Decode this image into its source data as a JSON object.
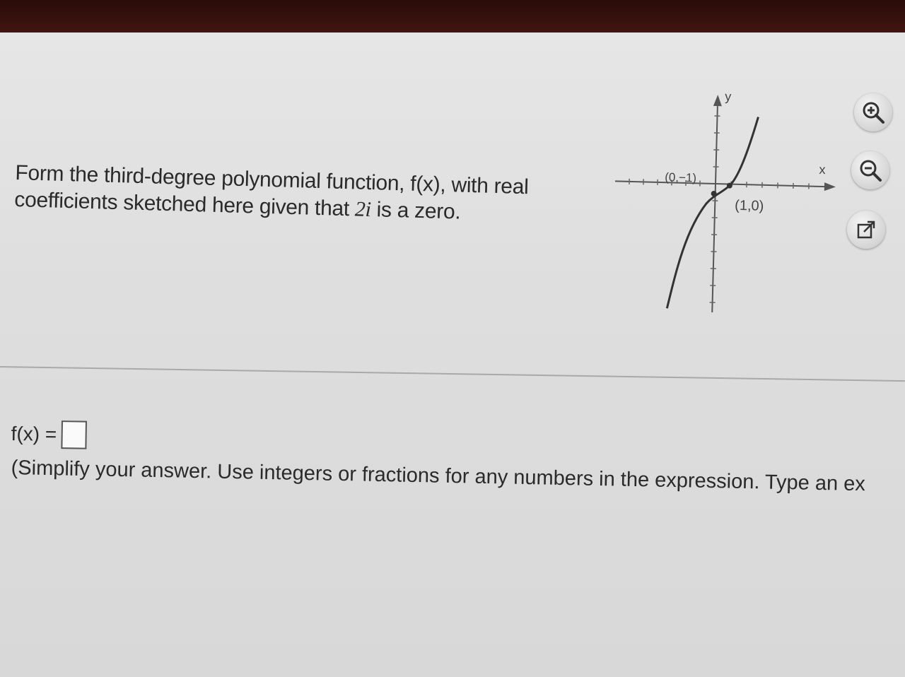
{
  "question": {
    "text_before": "Form the third-degree polynomial function, f(x), with real coefficients sketched here given that ",
    "zero": "2i",
    "text_after": " is a zero."
  },
  "graph": {
    "x_axis_label": "x",
    "y_axis_label": "y",
    "point_labels": [
      "(0,−1)",
      "(1,0)"
    ]
  },
  "tools": {
    "zoom_in": "zoom-in-icon",
    "zoom_out": "zoom-out-icon",
    "popout": "external-link-icon"
  },
  "answer": {
    "label": "f(x) =",
    "value": ""
  },
  "hint": "(Simplify your answer. Use integers or fractions for any numbers in the expression. Type an ex"
}
